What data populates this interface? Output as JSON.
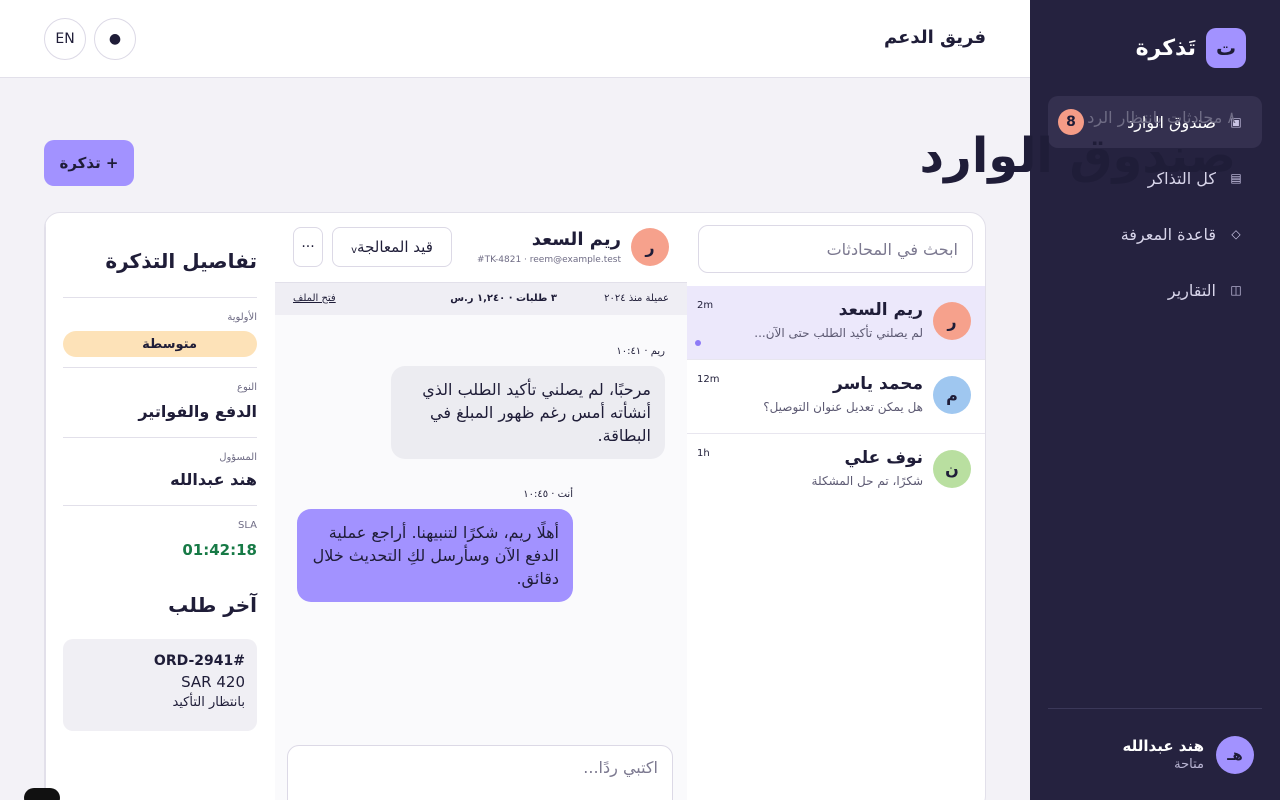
{
  "sidebar": {
    "brand_logo": "ت",
    "brand_name": "تَذكرة",
    "items": [
      {
        "label": "صندوق الوارد",
        "icon": "inbox-icon",
        "glyph": "▣",
        "badge": "8"
      },
      {
        "label": "كل التذاكر",
        "icon": "list-icon",
        "glyph": "▤"
      },
      {
        "label": "قاعدة المعرفة",
        "icon": "diamond-icon",
        "glyph": "◇"
      },
      {
        "label": "التقارير",
        "icon": "columns-icon",
        "glyph": "◫"
      }
    ],
    "user": {
      "avatar": "هـ",
      "name": "هند عبدالله",
      "status": "متاحة"
    }
  },
  "topbar": {
    "team_title": "فريق الدعم",
    "lang_label": "EN",
    "theme_glyph": "●"
  },
  "header": {
    "subtitle": "٨ محادثات بانتظار الرد",
    "title": "صندوق الوارد",
    "new_ticket_label": "+ تذكرة"
  },
  "search": {
    "placeholder": "ابحث في المحادثات"
  },
  "conversations": [
    {
      "avatar": "ر",
      "name": "ريم السعد",
      "preview": "لم يصلني تأكيد الطلب حتى الآن...",
      "time": "2m",
      "color": "#f6a18c",
      "unread": true
    },
    {
      "avatar": "م",
      "name": "محمد ياسر",
      "preview": "هل يمكن تعديل عنوان التوصيل؟",
      "time": "12m",
      "color": "#9fc7f0"
    },
    {
      "avatar": "ن",
      "name": "نوف علي",
      "preview": "شكرًا، تم حل المشكلة",
      "time": "1h",
      "color": "#b9dfa0"
    }
  ],
  "chat": {
    "avatar": "ر",
    "name": "ريم السعد",
    "meta": "TK-4821 · reem@example.test#",
    "status": "قيد المعالجة",
    "more": "···",
    "customer_since": "عميلة منذ ٢٠٢٤",
    "stats": "٣ طلبات · ١,٢٤٠ ر.س",
    "open_file": "فتح الملف",
    "messages": [
      {
        "from": "in",
        "label": "ريم · ١٠:٤١",
        "text": "مرحبًا، لم يصلني تأكيد الطلب الذي أنشأته أمس رغم ظهور المبلغ في البطاقة."
      },
      {
        "from": "out",
        "label": "أنت · ١٠:٤٥",
        "text": "أهلًا ريم، شكرًا لتنبيهنا. أراجع عملية الدفع الآن وسأرسل لكِ التحديث خلال دقائق."
      }
    ],
    "composer_placeholder": "اكتبي ردًا..."
  },
  "details": {
    "title": "تفاصيل التذكرة",
    "priority": {
      "label": "الأولوية",
      "value": "متوسطة"
    },
    "type": {
      "label": "النوع",
      "value": "الدفع والفواتير"
    },
    "assignee": {
      "label": "المسؤول",
      "value": "هند عبدالله"
    },
    "sla": {
      "label": "SLA",
      "value": "01:42:18"
    },
    "last_order_title": "آخر طلب",
    "order": {
      "id": "ORD-2941#",
      "amount": "SAR 420",
      "status": "بانتظار التأكيد"
    }
  }
}
